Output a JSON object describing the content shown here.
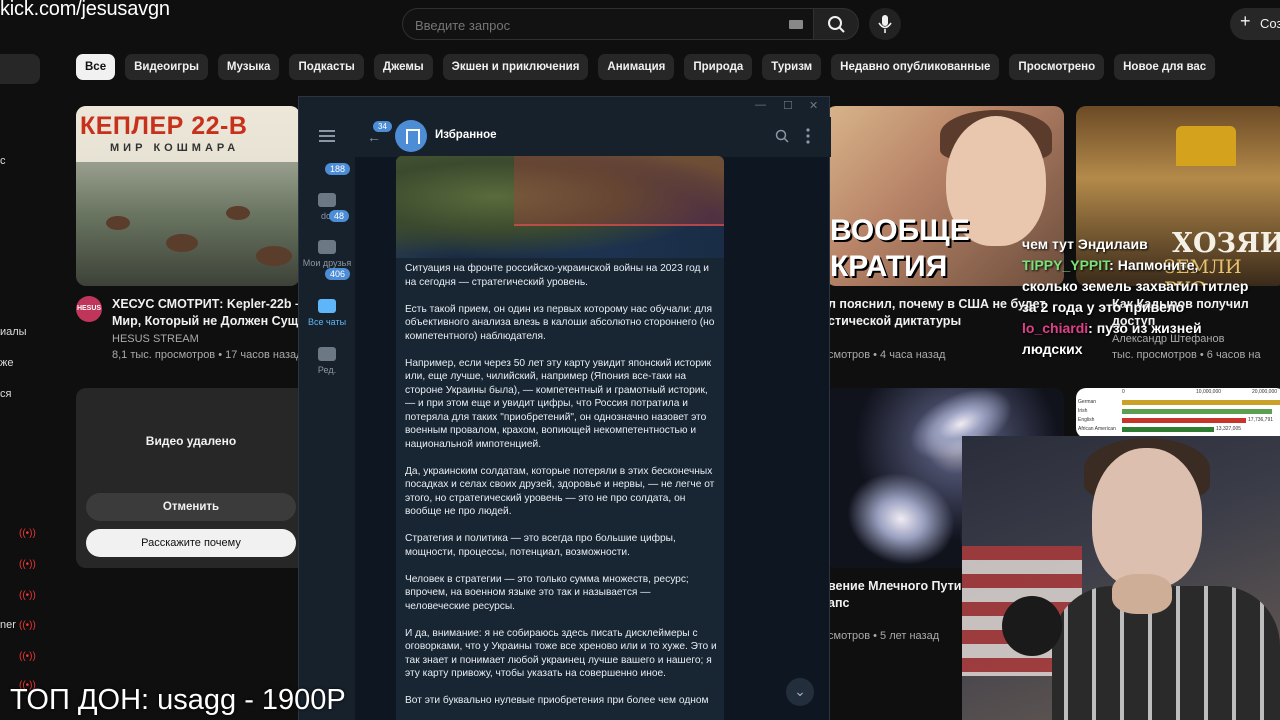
{
  "overlay": {
    "url": "kick.com/jesusavgn",
    "bottom_text": "ТОП ДОН: usagg - 1900Р"
  },
  "youtube": {
    "search_placeholder": "Введите запрос",
    "create_label": "Соз",
    "chips": [
      "Все",
      "Видеоигры",
      "Музыка",
      "Подкасты",
      "Джемы",
      "Экшен и приключения",
      "Анимация",
      "Природа",
      "Туризм",
      "Недавно опубликованные",
      "Просмотрено",
      "Новое для вас"
    ],
    "sidebar_fragments": [
      "с",
      "иалы",
      "же",
      "ся",
      "ner"
    ],
    "video1": {
      "thumb_title": "КЕПЛЕР 22-В",
      "thumb_subtitle": "МИР КОШМАРА",
      "avatar_text": "HESUS",
      "title_line1": "ХЕСУС СМОТРИТ: Kepler-22b – И",
      "title_line2": "Мир, Который не Должен Сущес",
      "channel": "HESUS STREAM",
      "meta": "8,1 тыс. просмотров • 17 часов назад"
    },
    "deleted": {
      "title": "Видео удалено",
      "cancel": "Отменить",
      "report": "Расскажите почему"
    },
    "video3": {
      "thumb_line1": "ВООБЩЕ",
      "thumb_line2": "КРАТИЯ",
      "title_line1": "л пояснил, почему в США не будет",
      "title_line2": "стической диктатуры",
      "meta": "смотров • 4 часа назад"
    },
    "video4": {
      "thumb_word1": "ХОЗЯИ",
      "thumb_word2": "ЗЕМЛИ РУС",
      "title_line1": "Как Кадыров получил доступ",
      "channel": "Александр Штефанов",
      "meta": "тыс. просмотров • 6 часов на"
    },
    "video5": {
      "title_line1": "вение Млечного Пути и",
      "title_line2": "апс",
      "meta": "смотров • 5 лет назад"
    },
    "video6": {
      "labels": [
        "German",
        "Irish",
        "English",
        "African American"
      ],
      "values_text": [
        "17,736,791",
        "13,327,005"
      ],
      "axis": [
        "0",
        "10,000,000",
        "20,000,000"
      ]
    }
  },
  "chat_overlay": [
    {
      "user": "",
      "text": "чем тут Эндилаив"
    },
    {
      "user": "TIPPY_YPPIT",
      "text": ": Напмоните,"
    },
    {
      "user": "",
      "text": "сколько земель захватил гитлер"
    },
    {
      "user": "",
      "text": "за 2 года         у это привело"
    },
    {
      "user": "lo_chiardi",
      "text": ": пузо из жизней"
    },
    {
      "user": "",
      "text": "людских"
    }
  ],
  "telegram": {
    "chat_title": "Избранное",
    "back_badge": "34",
    "folders": [
      {
        "label": "dct",
        "badge": "188"
      },
      {
        "label": "Мои друзья",
        "badge": "48"
      },
      {
        "label": "Все чаты",
        "badge": "406"
      },
      {
        "label": "Ред.",
        "badge": ""
      }
    ],
    "message_paragraphs": [
      "Ситуация на фронте российско-украинской войны на 2023 год и на сегодня — стратегический уровень.",
      "Есть такой прием, он один из первых которому нас обучали: для объективного анализа влезь в калоши абсолютно стороннего (но компетентного) наблюдателя.",
      "Например, если через 50 лет эту карту увидит японский историк или, еще лучше, чилийский, например (Япония все-таки на стороне Украины была), — компетентный и грамотный историк, — и при этом еще и увидит цифры, что Россия потратила и потеряла для таких \"приобретений\", он однозначно назовет это военным провалом, крахом, вопиющей некомпетентностью и национальной импотенцией.",
      "Да, украинским солдатам, которые потеряли в этих бесконечных посадках и селах своих друзей, здоровье и нервы, — не легче от этого, но стратегический уровень — это не про солдата, он вообще не про людей.",
      "Стратегия и политика — это всегда про большие цифры, мощности, процессы, потенциал, возможности.",
      "Человек в стратегии — это только сумма множеств, ресурс; впрочем, на военном языке это так и называется — человеческие ресурсы.",
      "И да, внимание: я не собираюсь здесь писать дисклеймеры с оговорками, что у Украины тоже все хреново или и то хуже. Это и так знает и понимает любой украинец лучше вашего и нашего; я эту карту привожу, чтобы указать на совершенно иное.",
      "Вот эти буквально нулевые приобретения при более чем одном"
    ]
  },
  "colors": {
    "accent": "#4c8dd6",
    "youtube_bg": "#0f0f0f",
    "telegram_bg": "#0e1621",
    "bubble": "#182533",
    "kepler_red": "#c7311b"
  }
}
